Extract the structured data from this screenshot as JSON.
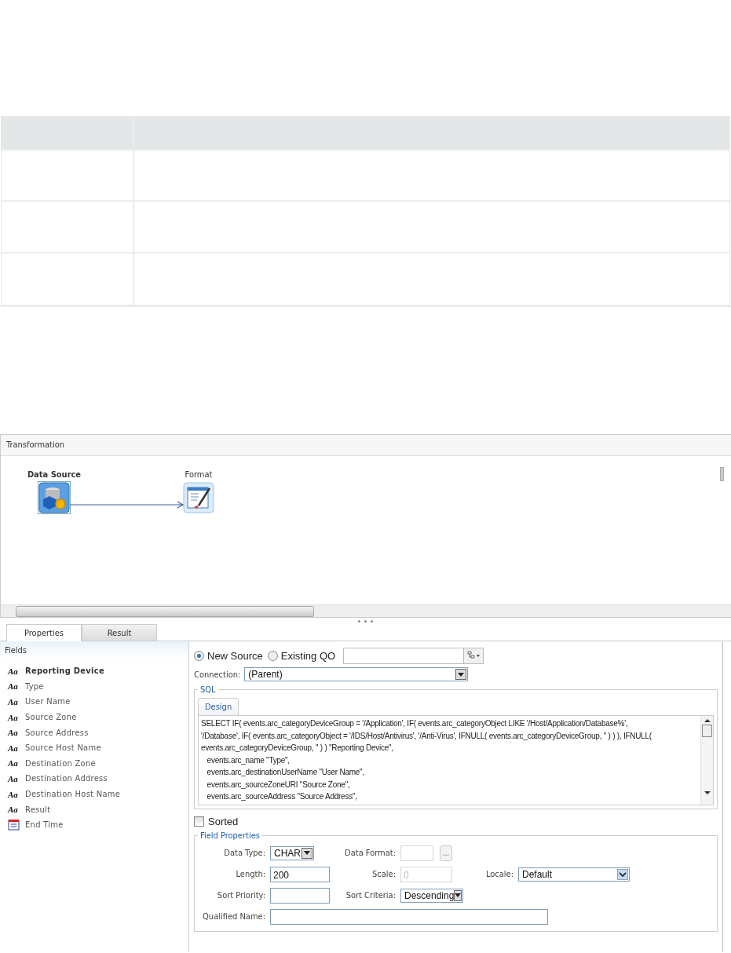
{
  "transformation": {
    "title": "Transformation",
    "nodes": [
      {
        "label": "Data Source",
        "selected": true,
        "kind": "source"
      },
      {
        "label": "Format",
        "selected": false,
        "kind": "format"
      }
    ]
  },
  "tabs": [
    {
      "label": "Properties",
      "selected": true
    },
    {
      "label": "Result",
      "selected": false
    }
  ],
  "fields": {
    "title": "Fields",
    "items": [
      {
        "label": "Reporting Device",
        "kind": "text",
        "icon": "Aa",
        "selected": true
      },
      {
        "label": "Type",
        "kind": "text",
        "icon": "Aa",
        "selected": false
      },
      {
        "label": "User Name",
        "kind": "text",
        "icon": "Aa",
        "selected": false
      },
      {
        "label": "Source Zone",
        "kind": "text",
        "icon": "Aa",
        "selected": false
      },
      {
        "label": "Source Address",
        "kind": "text",
        "icon": "Aa",
        "selected": false
      },
      {
        "label": "Source Host Name",
        "kind": "text",
        "icon": "Aa",
        "selected": false
      },
      {
        "label": "Destination Zone",
        "kind": "text",
        "icon": "Aa",
        "selected": false
      },
      {
        "label": "Destination Address",
        "kind": "text",
        "icon": "Aa",
        "selected": false
      },
      {
        "label": "Destination Host Name",
        "kind": "text",
        "icon": "Aa",
        "selected": false
      },
      {
        "label": "Result",
        "kind": "text",
        "icon": "Aa",
        "selected": false
      },
      {
        "label": "End Time",
        "kind": "date",
        "selected": false
      }
    ]
  },
  "source": {
    "options": [
      {
        "label": "New Source",
        "selected": true
      },
      {
        "label": "Existing QO",
        "selected": false
      }
    ],
    "connection_label": "Connection:",
    "connection": "(Parent)",
    "sql_title": "SQL",
    "sql_tab": "Design",
    "sql_lines": [
      "SELECT IF( events.arc_categoryDeviceGroup = '/Application', IF( events.arc_categoryObject LIKE '/Host/Application/Database%',",
      "'/Database', IF( events.arc_categoryObject = '/IDS/Host/Antivirus', '/Anti-Virus', IFNULL( events.arc_categoryDeviceGroup, '' ) ) ), IFNULL(",
      "events.arc_categoryDeviceGroup, '' ) ) \"Reporting Device\",",
      "   events.arc_name \"Type\",",
      "   events.arc_destinationUserName \"User Name\",",
      "   events.arc_sourceZoneURI \"Source Zone\",",
      "   events.arc_sourceAddress \"Source Address\","
    ],
    "sorted_label": "Sorted",
    "sorted_checked": false
  },
  "field_properties": {
    "title": "Field Properties",
    "data_type_label": "Data Type:",
    "data_type": "CHAR",
    "data_format_label": "Data Format:",
    "data_format_button": "...",
    "length_label": "Length:",
    "length": "200",
    "scale_label": "Scale:",
    "scale": "0",
    "locale_label": "Locale:",
    "locale": "Default",
    "sort_priority_label": "Sort Priority:",
    "sort_criteria_label": "Sort Criteria:",
    "sort_criteria": "Descending",
    "qualified_name_label": "Qualified Name:"
  }
}
